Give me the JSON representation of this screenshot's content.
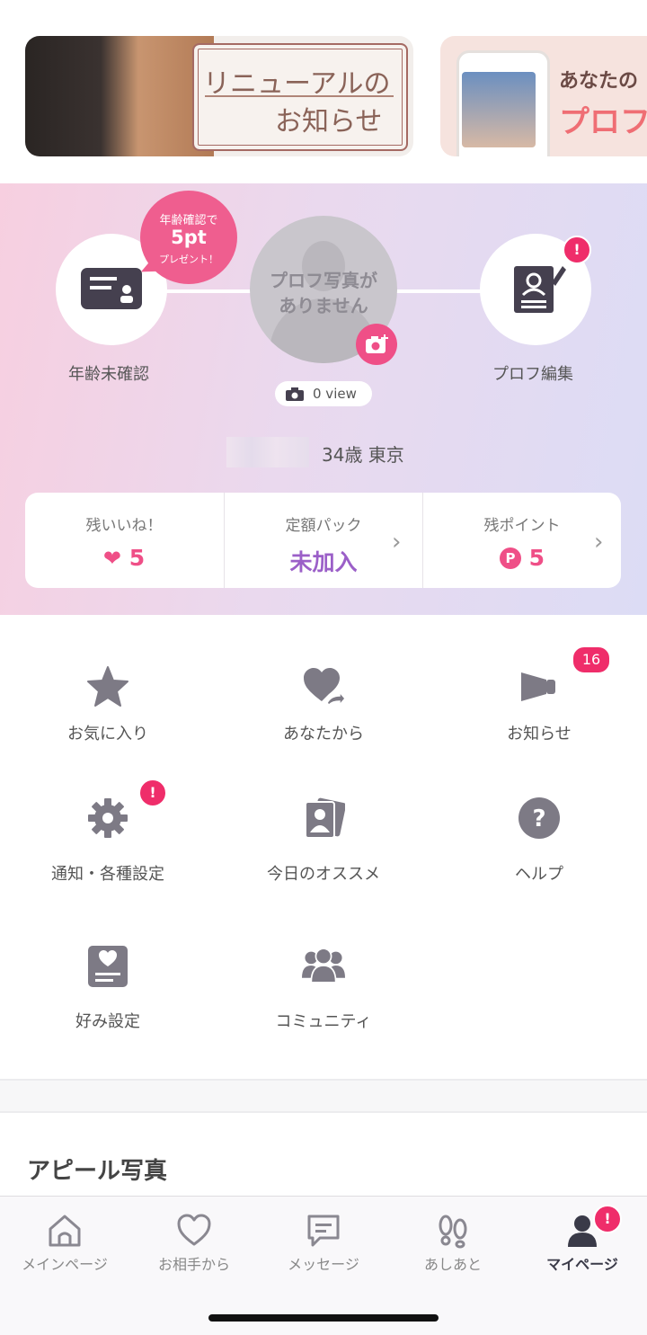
{
  "banners": [
    {
      "line1": "リニューアルの",
      "line2": "お知らせ"
    },
    {
      "line1": "あなたの",
      "line2": "プロフ"
    }
  ],
  "profile": {
    "bubble": {
      "line1": "年齢確認で",
      "line2": "5pt",
      "line3": "プレゼント！"
    },
    "age_verify_label": "年齢未確認",
    "photo_placeholder_line1": "プロフ写真が",
    "photo_placeholder_line2": "ありません",
    "edit_label": "プロフ編集",
    "edit_alert": "!",
    "views": "0 view",
    "age_location": "34歳 東京"
  },
  "stats": [
    {
      "label": "残いいね！",
      "value": "5",
      "icon": "heart-icon"
    },
    {
      "label": "定額パック",
      "value": "未加入"
    },
    {
      "label": "残ポイント",
      "value": "5",
      "icon": "point-icon"
    }
  ],
  "menu": [
    {
      "label": "お気に入り",
      "icon": "star-icon"
    },
    {
      "label": "あなたから",
      "icon": "heart-arrow-icon"
    },
    {
      "label": "お知らせ",
      "icon": "megaphone-icon",
      "badge": "16"
    },
    {
      "label": "通知・各種設定",
      "icon": "gear-icon",
      "alert": "!"
    },
    {
      "label": "今日のオススメ",
      "icon": "photo-cards-icon"
    },
    {
      "label": "ヘルプ",
      "icon": "help-icon"
    },
    {
      "label": "好み設定",
      "icon": "preference-card-icon"
    },
    {
      "label": "コミュニティ",
      "icon": "community-icon"
    }
  ],
  "section_title": "アピール写真",
  "tabs": [
    {
      "label": "メインページ",
      "icon": "home-icon"
    },
    {
      "label": "お相手から",
      "icon": "heart-outline-icon"
    },
    {
      "label": "メッセージ",
      "icon": "message-icon"
    },
    {
      "label": "あしあと",
      "icon": "footprints-icon"
    },
    {
      "label": "マイページ",
      "icon": "person-icon",
      "active": true,
      "alert": "!"
    }
  ],
  "colors": {
    "accent": "#ef2d6a",
    "purple": "#9b5fc8",
    "pink": "#ef4f87"
  }
}
